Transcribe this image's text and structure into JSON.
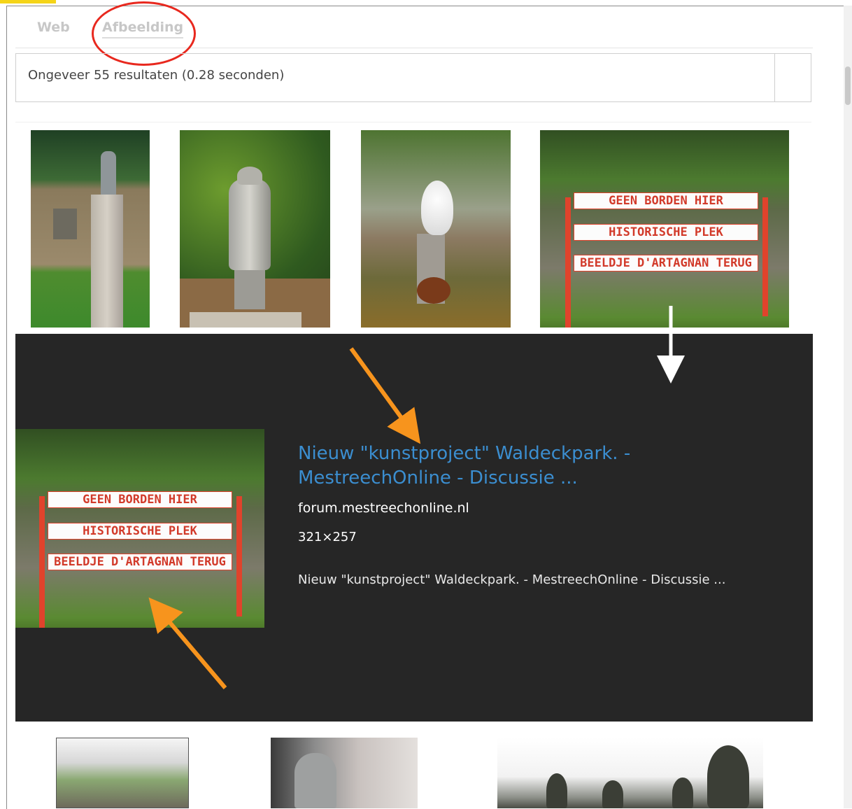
{
  "tabs": {
    "web": "Web",
    "images": "Afbeelding"
  },
  "results": {
    "stats": "Ongeveer 55 resultaten (0.28 seconden)"
  },
  "thumbnails": [
    {
      "subject": "statue-on-pillar"
    },
    {
      "subject": "bronze-statue"
    },
    {
      "subject": "urinal-on-pillar"
    },
    {
      "subject": "signboard",
      "signs": [
        "GEEN BORDEN HIER",
        "HISTORISCHE PLEK",
        "BEELDJE D'ARTAGNAN TERUG"
      ]
    }
  ],
  "preview": {
    "signs": [
      "GEEN BORDEN HIER",
      "HISTORISCHE PLEK",
      "BEELDJE D'ARTAGNAN TERUG"
    ],
    "title": "Nieuw \"kunstproject\" Waldeckpark. - MestreechOnline - Discussie ...",
    "domain": "forum.mestreechonline.nl",
    "size": "321×257",
    "description": "Nieuw \"kunstproject\" Waldeckpark. - MestreechOnline - Discussie ..."
  },
  "annotations": {
    "circle_color": "#e8281e",
    "arrow_color": "#f7941d",
    "white_arrow_color": "#ffffff"
  },
  "colors": {
    "preview_bg": "#262626",
    "title_link": "#3b8ed0",
    "sign_red": "#e0432c"
  }
}
